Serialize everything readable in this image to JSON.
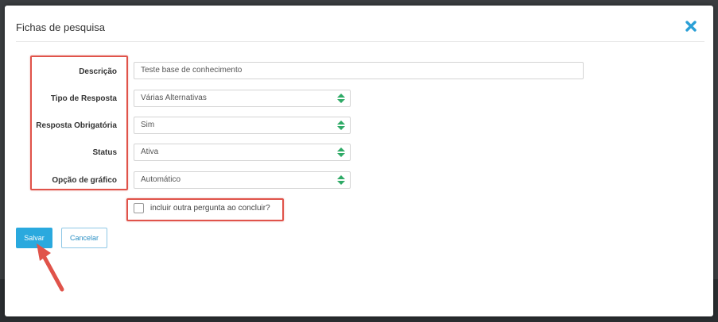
{
  "modal": {
    "title": "Fichas de pesquisa",
    "close_icon": "close-x-icon"
  },
  "form": {
    "descricao": {
      "label": "Descrição",
      "value": "Teste base de conhecimento"
    },
    "tipo_resposta": {
      "label": "Tipo de Resposta",
      "value": "Várias Alternativas"
    },
    "resposta_obrigatoria": {
      "label": "Resposta Obrigatória",
      "value": "Sim"
    },
    "status": {
      "label": "Status",
      "value": "Ativa"
    },
    "opcao_grafico": {
      "label": "Opção de gráfico",
      "value": "Automático"
    },
    "incluir_outra": {
      "label": "incluir outra pergunta ao concluir?",
      "checked": false
    }
  },
  "actions": {
    "save_label": "Salvar",
    "cancel_label": "Cancelar"
  },
  "colors": {
    "primary": "#2aa9de",
    "annotation": "#e0534a",
    "close_icon": "#2a9fd6",
    "select_arrows": "#2eaa66"
  }
}
